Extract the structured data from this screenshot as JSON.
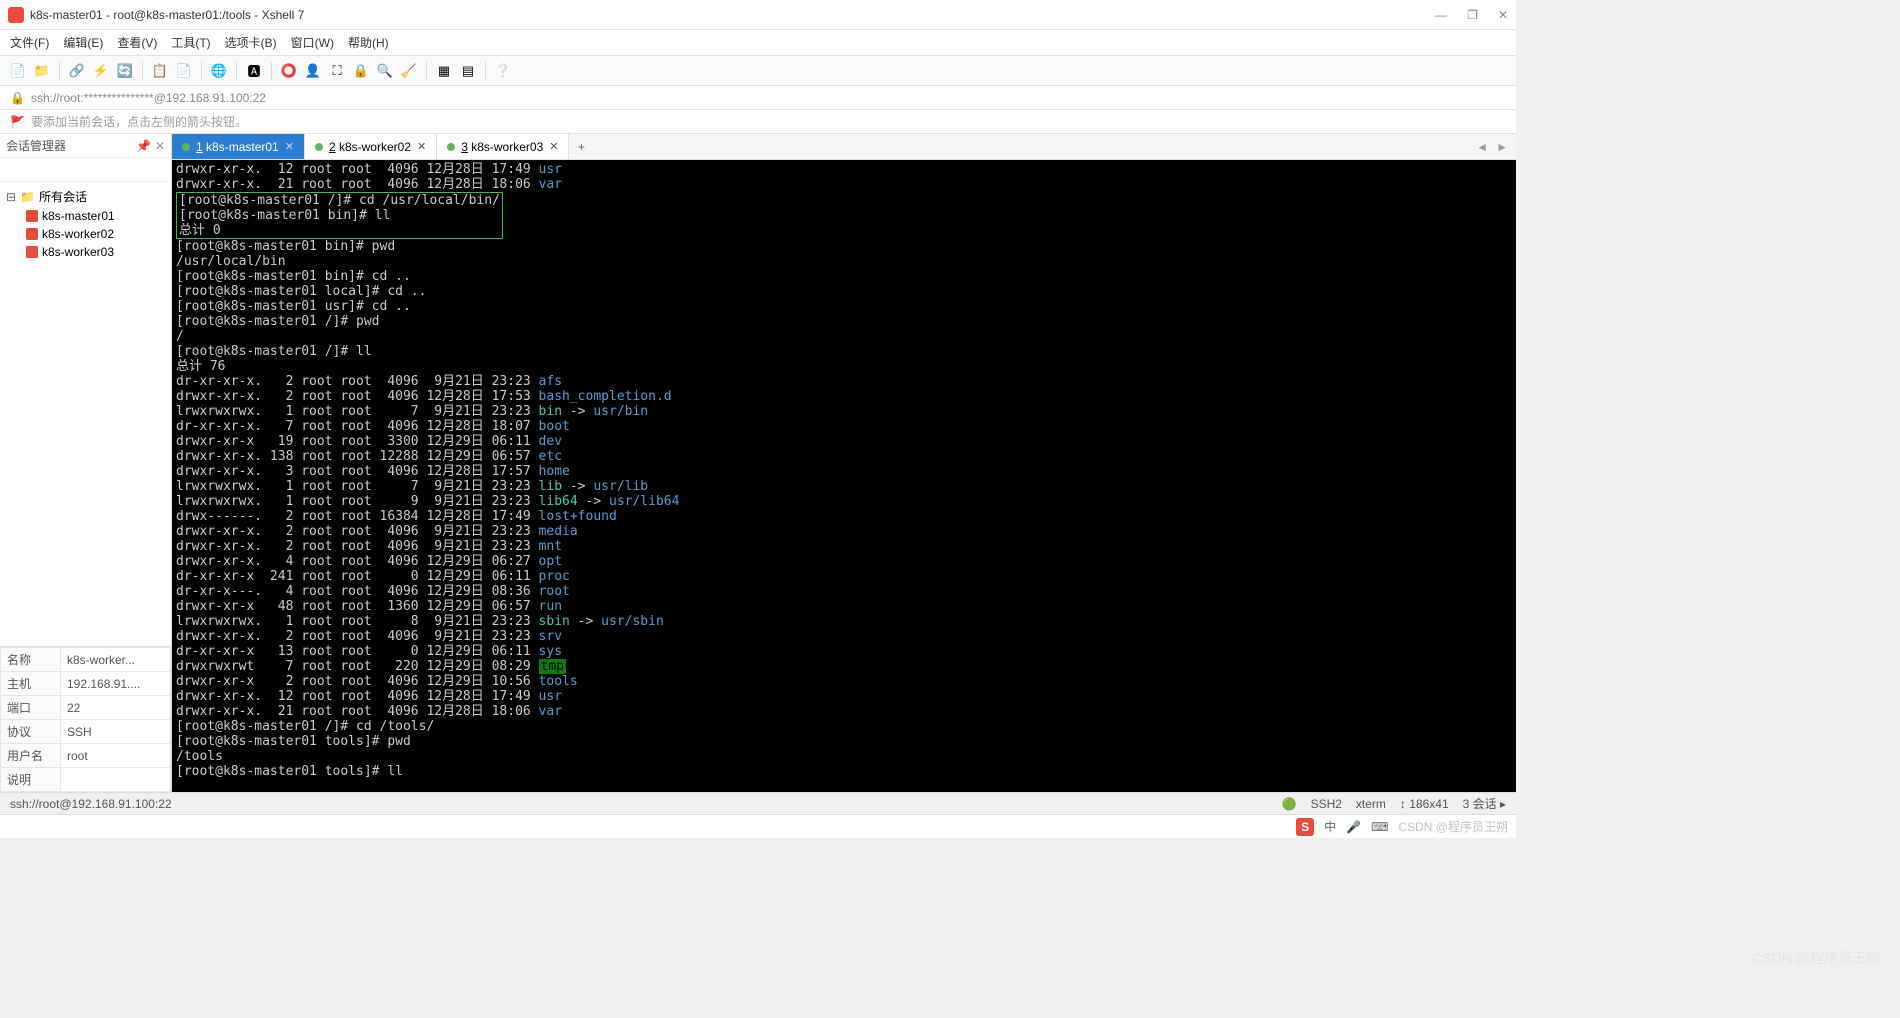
{
  "window": {
    "title": "k8s-master01 - root@k8s-master01:/tools - Xshell 7",
    "min": "—",
    "max": "❐",
    "close": "✕"
  },
  "menu": [
    "文件(F)",
    "编辑(E)",
    "查看(V)",
    "工具(T)",
    "选项卡(B)",
    "窗口(W)",
    "帮助(H)"
  ],
  "address": "ssh://root:***************@192.168.91.100:22",
  "tip": "要添加当前会话，点击左侧的箭头按钮。",
  "sidebar": {
    "title": "会话管理器",
    "pin": "📌",
    "x": "✕",
    "search_placeholder": "",
    "root": "所有会话",
    "items": [
      "k8s-master01",
      "k8s-worker02",
      "k8s-worker03"
    ]
  },
  "props": {
    "rows": [
      [
        "名称",
        "k8s-worker..."
      ],
      [
        "主机",
        "192.168.91...."
      ],
      [
        "端口",
        "22"
      ],
      [
        "协议",
        "SSH"
      ],
      [
        "用户名",
        "root"
      ],
      [
        "说明",
        ""
      ]
    ]
  },
  "tabs": {
    "items": [
      {
        "num": "1",
        "label": "k8s-master01",
        "active": true
      },
      {
        "num": "2",
        "label": "k8s-worker02",
        "active": false
      },
      {
        "num": "3",
        "label": "k8s-worker03",
        "active": false
      }
    ],
    "add": "+"
  },
  "terminal": {
    "pre_box": [
      {
        "t": "drwxr-xr-x.  12 root root  4096 12月28日 17:49 ",
        "c": "usr"
      },
      {
        "t": "drwxr-xr-x.  21 root root  4096 12月28日 18:06 ",
        "c": "var"
      }
    ],
    "box": [
      "[root@k8s-master01 /]# cd /usr/local/bin/",
      "[root@k8s-master01 bin]# ll",
      "总计 0"
    ],
    "post": [
      {
        "p": "[root@k8s-master01 bin]# ",
        "cmd": "pwd"
      },
      {
        "p": "/usr/local/bin"
      },
      {
        "p": "[root@k8s-master01 bin]# ",
        "cmd": "cd .."
      },
      {
        "p": "[root@k8s-master01 local]# ",
        "cmd": "cd .."
      },
      {
        "p": "[root@k8s-master01 usr]# ",
        "cmd": "cd .."
      },
      {
        "p": "[root@k8s-master01 /]# ",
        "cmd": "pwd"
      },
      {
        "p": "/"
      },
      {
        "p": "[root@k8s-master01 /]# ",
        "cmd": "ll"
      },
      {
        "p": "总计 76"
      }
    ],
    "listing": [
      {
        "perm": "dr-xr-xr-x.",
        "n": "   2",
        "own": "root root",
        "size": "  4096",
        "date": " 9月21日 23:23",
        "name": "afs",
        "cls": "blue"
      },
      {
        "perm": "drwxr-xr-x.",
        "n": "   2",
        "own": "root root",
        "size": "  4096",
        "date": "12月28日 17:53",
        "name": "bash_completion.d",
        "cls": "blue"
      },
      {
        "perm": "lrwxrwxrwx.",
        "n": "   1",
        "own": "root root",
        "size": "     7",
        "date": " 9月21日 23:23",
        "name": "bin",
        "cls": "cyan",
        "arrow": " -> ",
        "tgt": "usr/bin",
        "tcls": "blue"
      },
      {
        "perm": "dr-xr-xr-x.",
        "n": "   7",
        "own": "root root",
        "size": "  4096",
        "date": "12月28日 18:07",
        "name": "boot",
        "cls": "blue"
      },
      {
        "perm": "drwxr-xr-x ",
        "n": "  19",
        "own": "root root",
        "size": "  3300",
        "date": "12月29日 06:11",
        "name": "dev",
        "cls": "blue"
      },
      {
        "perm": "drwxr-xr-x.",
        "n": " 138",
        "own": "root root",
        "size": " 12288",
        "date": "12月29日 06:57",
        "name": "etc",
        "cls": "blue"
      },
      {
        "perm": "drwxr-xr-x.",
        "n": "   3",
        "own": "root root",
        "size": "  4096",
        "date": "12月28日 17:57",
        "name": "home",
        "cls": "blue"
      },
      {
        "perm": "lrwxrwxrwx.",
        "n": "   1",
        "own": "root root",
        "size": "     7",
        "date": " 9月21日 23:23",
        "name": "lib",
        "cls": "cyan",
        "arrow": " -> ",
        "tgt": "usr/lib",
        "tcls": "blue"
      },
      {
        "perm": "lrwxrwxrwx.",
        "n": "   1",
        "own": "root root",
        "size": "     9",
        "date": " 9月21日 23:23",
        "name": "lib64",
        "cls": "cyan",
        "arrow": " -> ",
        "tgt": "usr/lib64",
        "tcls": "blue"
      },
      {
        "perm": "drwx------.",
        "n": "   2",
        "own": "root root",
        "size": " 16384",
        "date": "12月28日 17:49",
        "name": "lost+found",
        "cls": "blue"
      },
      {
        "perm": "drwxr-xr-x.",
        "n": "   2",
        "own": "root root",
        "size": "  4096",
        "date": " 9月21日 23:23",
        "name": "media",
        "cls": "blue"
      },
      {
        "perm": "drwxr-xr-x.",
        "n": "   2",
        "own": "root root",
        "size": "  4096",
        "date": " 9月21日 23:23",
        "name": "mnt",
        "cls": "blue"
      },
      {
        "perm": "drwxr-xr-x.",
        "n": "   4",
        "own": "root root",
        "size": "  4096",
        "date": "12月29日 06:27",
        "name": "opt",
        "cls": "blue"
      },
      {
        "perm": "dr-xr-xr-x ",
        "n": " 241",
        "own": "root root",
        "size": "     0",
        "date": "12月29日 06:11",
        "name": "proc",
        "cls": "blue"
      },
      {
        "perm": "dr-xr-x---.",
        "n": "   4",
        "own": "root root",
        "size": "  4096",
        "date": "12月29日 08:36",
        "name": "root",
        "cls": "blue"
      },
      {
        "perm": "drwxr-xr-x ",
        "n": "  48",
        "own": "root root",
        "size": "  1360",
        "date": "12月29日 06:57",
        "name": "run",
        "cls": "blue"
      },
      {
        "perm": "lrwxrwxrwx.",
        "n": "   1",
        "own": "root root",
        "size": "     8",
        "date": " 9月21日 23:23",
        "name": "sbin",
        "cls": "cyan",
        "arrow": " -> ",
        "tgt": "usr/sbin",
        "tcls": "blue"
      },
      {
        "perm": "drwxr-xr-x.",
        "n": "   2",
        "own": "root root",
        "size": "  4096",
        "date": " 9月21日 23:23",
        "name": "srv",
        "cls": "blue"
      },
      {
        "perm": "dr-xr-xr-x ",
        "n": "  13",
        "own": "root root",
        "size": "     0",
        "date": "12月29日 06:11",
        "name": "sys",
        "cls": "blue"
      },
      {
        "perm": "drwxrwxrwt ",
        "n": "   7",
        "own": "root root",
        "size": "   220",
        "date": "12月29日 08:29",
        "name": "tmp",
        "cls": "hlgreen"
      },
      {
        "perm": "drwxr-xr-x ",
        "n": "   2",
        "own": "root root",
        "size": "  4096",
        "date": "12月29日 10:56",
        "name": "tools",
        "cls": "blue"
      },
      {
        "perm": "drwxr-xr-x.",
        "n": "  12",
        "own": "root root",
        "size": "  4096",
        "date": "12月28日 17:49",
        "name": "usr",
        "cls": "blue"
      },
      {
        "perm": "drwxr-xr-x.",
        "n": "  21",
        "own": "root root",
        "size": "  4096",
        "date": "12月28日 18:06",
        "name": "var",
        "cls": "blue"
      }
    ],
    "tail": [
      {
        "p": "[root@k8s-master01 /]# ",
        "cmd": "cd /tools/"
      },
      {
        "p": "[root@k8s-master01 tools]# ",
        "cmd": "pwd"
      },
      {
        "p": "/tools"
      },
      {
        "p": "[root@k8s-master01 tools]# ",
        "cmd": "ll"
      }
    ]
  },
  "status": {
    "left": "ssh://root@192.168.91.100:22",
    "ssh": "SSH2",
    "term": "xterm",
    "size": "↕ 186x41",
    "enc": "",
    "sess": "3 会话 ▸"
  },
  "taskbar": {
    "ime": "中",
    "items": [
      "🎤",
      "⌨",
      "CSDN @程序员王朔"
    ]
  },
  "watermark": "CSDN @程序员王朔"
}
